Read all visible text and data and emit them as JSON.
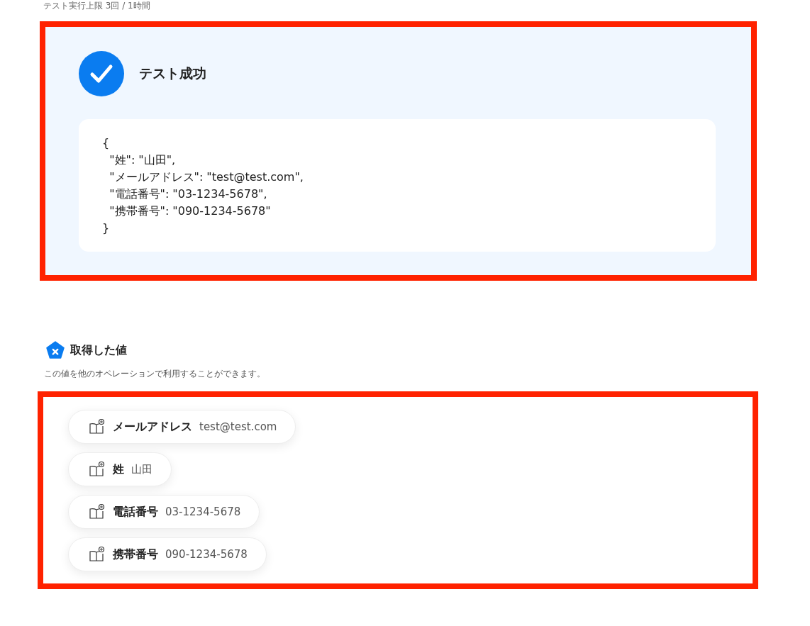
{
  "limit_note": "テスト実行上限 3回 / 1時間",
  "test_result": {
    "success": true,
    "title": "テスト成功",
    "output_lines": [
      "{",
      "  \"姓\": \"山田\",",
      "  \"メールアドレス\": \"test@test.com\",",
      "  \"電話番号\": \"03-1234-5678\",",
      "  \"携帯番号\": \"090-1234-5678\"",
      "}"
    ]
  },
  "retrieved_values": {
    "title": "取得した値",
    "description": "この値を他のオペレーションで利用することができます。",
    "items": [
      {
        "label": "メールアドレス",
        "value": "test@test.com"
      },
      {
        "label": "姓",
        "value": "山田"
      },
      {
        "label": "電話番号",
        "value": "03-1234-5678"
      },
      {
        "label": "携帯番号",
        "value": "090-1234-5678"
      }
    ]
  }
}
